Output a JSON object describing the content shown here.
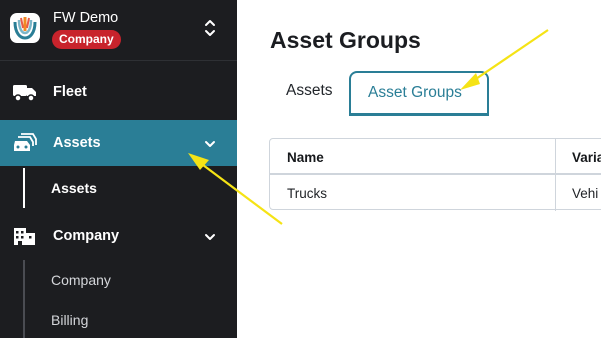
{
  "sidebar": {
    "org_name": "FW Demo",
    "org_badge": "Company",
    "nav": [
      {
        "label": "Fleet",
        "icon": "truck-icon"
      },
      {
        "label": "Assets",
        "icon": "vehicles-icon"
      },
      {
        "label": "Company",
        "icon": "building-icon"
      }
    ],
    "assets_sub": [
      {
        "label": "Assets"
      }
    ],
    "company_sub": [
      {
        "label": "Company"
      },
      {
        "label": "Billing"
      }
    ]
  },
  "main": {
    "title": "Asset Groups",
    "tabs": [
      {
        "label": "Assets"
      },
      {
        "label": "Asset Groups"
      }
    ],
    "table": {
      "headers": [
        "Name",
        "Varia"
      ],
      "rows": [
        [
          "Trucks",
          "Vehi"
        ]
      ]
    }
  },
  "colors": {
    "sidebar_bg": "#1c1d20",
    "accent": "#2a7e96",
    "badge": "#c8232c",
    "annotation_arrow": "#f5e315"
  }
}
